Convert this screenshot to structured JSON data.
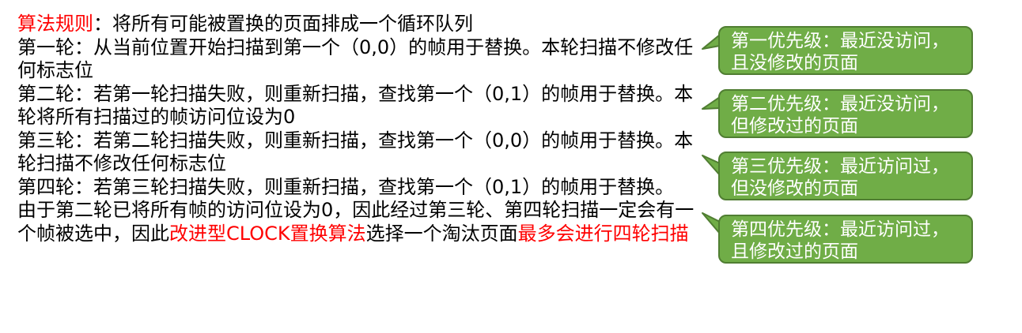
{
  "rule": {
    "label": "算法规则",
    "text": "：将所有可能被置换的页面排成一个循环队列"
  },
  "rounds": [
    "第一轮：从当前位置开始扫描到第一个（0,0）的帧用于替换。本轮扫描不修改任何标志位",
    "第二轮：若第一轮扫描失败，则重新扫描，查找第一个（0,1）的帧用于替换。本轮将所有扫描过的帧访问位设为0",
    "第三轮：若第二轮扫描失败，则重新扫描，查找第一个（0,0）的帧用于替换。本轮扫描不修改任何标志位",
    "第四轮：若第三轮扫描失败，则重新扫描，查找第一个（0,1）的帧用于替换。"
  ],
  "conclusion": {
    "part1": "由于第二轮已将所有帧的访问位设为0，因此经过第三轮、第四轮扫描一定会有一个帧被选中，因此",
    "highlight1": "改进型CLOCK置换算法",
    "part2": "选择一个淘汰页面",
    "highlight2": "最多会进行四轮扫描"
  },
  "callouts": [
    {
      "line1": "第一优先级：最近没访问，",
      "line2": "且没修改的页面"
    },
    {
      "line1": "第二优先级：最近没访问，",
      "line2": "但修改过的页面"
    },
    {
      "line1": "第三优先级：最近访问过，",
      "line2": "但没修改的页面"
    },
    {
      "line1": "第四优先级：最近访问过，",
      "line2": "且修改过的页面"
    }
  ],
  "colors": {
    "highlight": "#ff0000",
    "callout_fill": "#70ad47",
    "callout_border": "#507e32"
  }
}
